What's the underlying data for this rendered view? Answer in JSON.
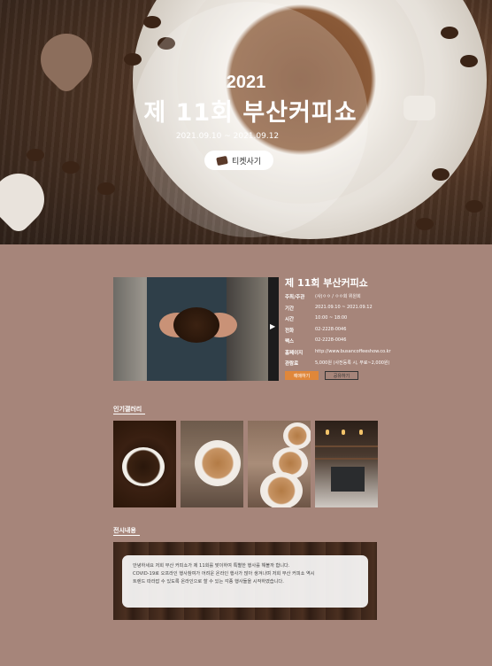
{
  "hero": {
    "year": "2021",
    "title": "제 11회 부산커피쇼",
    "dates": "2021.09.10 ~ 2021.09.12",
    "ticket_label": "티켓사기"
  },
  "info": {
    "title": "제 11회 부산커피쇼",
    "rows": [
      {
        "label": "주최/주관",
        "value": "(사)ㅇㅇ / ㅇㅇ회 위원회"
      },
      {
        "label": "기간",
        "value": "2021.09.10 ~ 2021.09.12"
      },
      {
        "label": "시간",
        "value": "10:00 ~ 18:00"
      },
      {
        "label": "전화",
        "value": "02-2228-0046"
      },
      {
        "label": "팩스",
        "value": "02-2228-0046"
      },
      {
        "label": "홈페이지",
        "value": "http://www.busancoffeeshow.co.kr"
      },
      {
        "label": "관람료",
        "value": "5,000원 (사전등록 시, 무료~2,000원)"
      }
    ],
    "reserve_label": "예매하기",
    "share_label": "공유하기"
  },
  "gallery": {
    "title": "인기갤러리",
    "images": [
      "coffee-beans-cup",
      "latte-cup",
      "latte-art-cups",
      "cafe-bar"
    ]
  },
  "exhibit": {
    "title": "전시내용",
    "lines": [
      "안녕하세요 저희 부산 커피쇼가 제 11회를 맞이하여 특별한 행사를 해볼까 합니다.",
      "COVID-19로 오프라인 행사참여가 어려운 온라인 행사가 많아 생겨나며 저희 부산 커피쇼 역시",
      "트렌드 따라잡 수 있도록 온라인으로 할 수 있는 각종 행사들을 시작하였습니다."
    ]
  },
  "colors": {
    "page_bg": "#a6857a",
    "accent": "#e0873a"
  }
}
